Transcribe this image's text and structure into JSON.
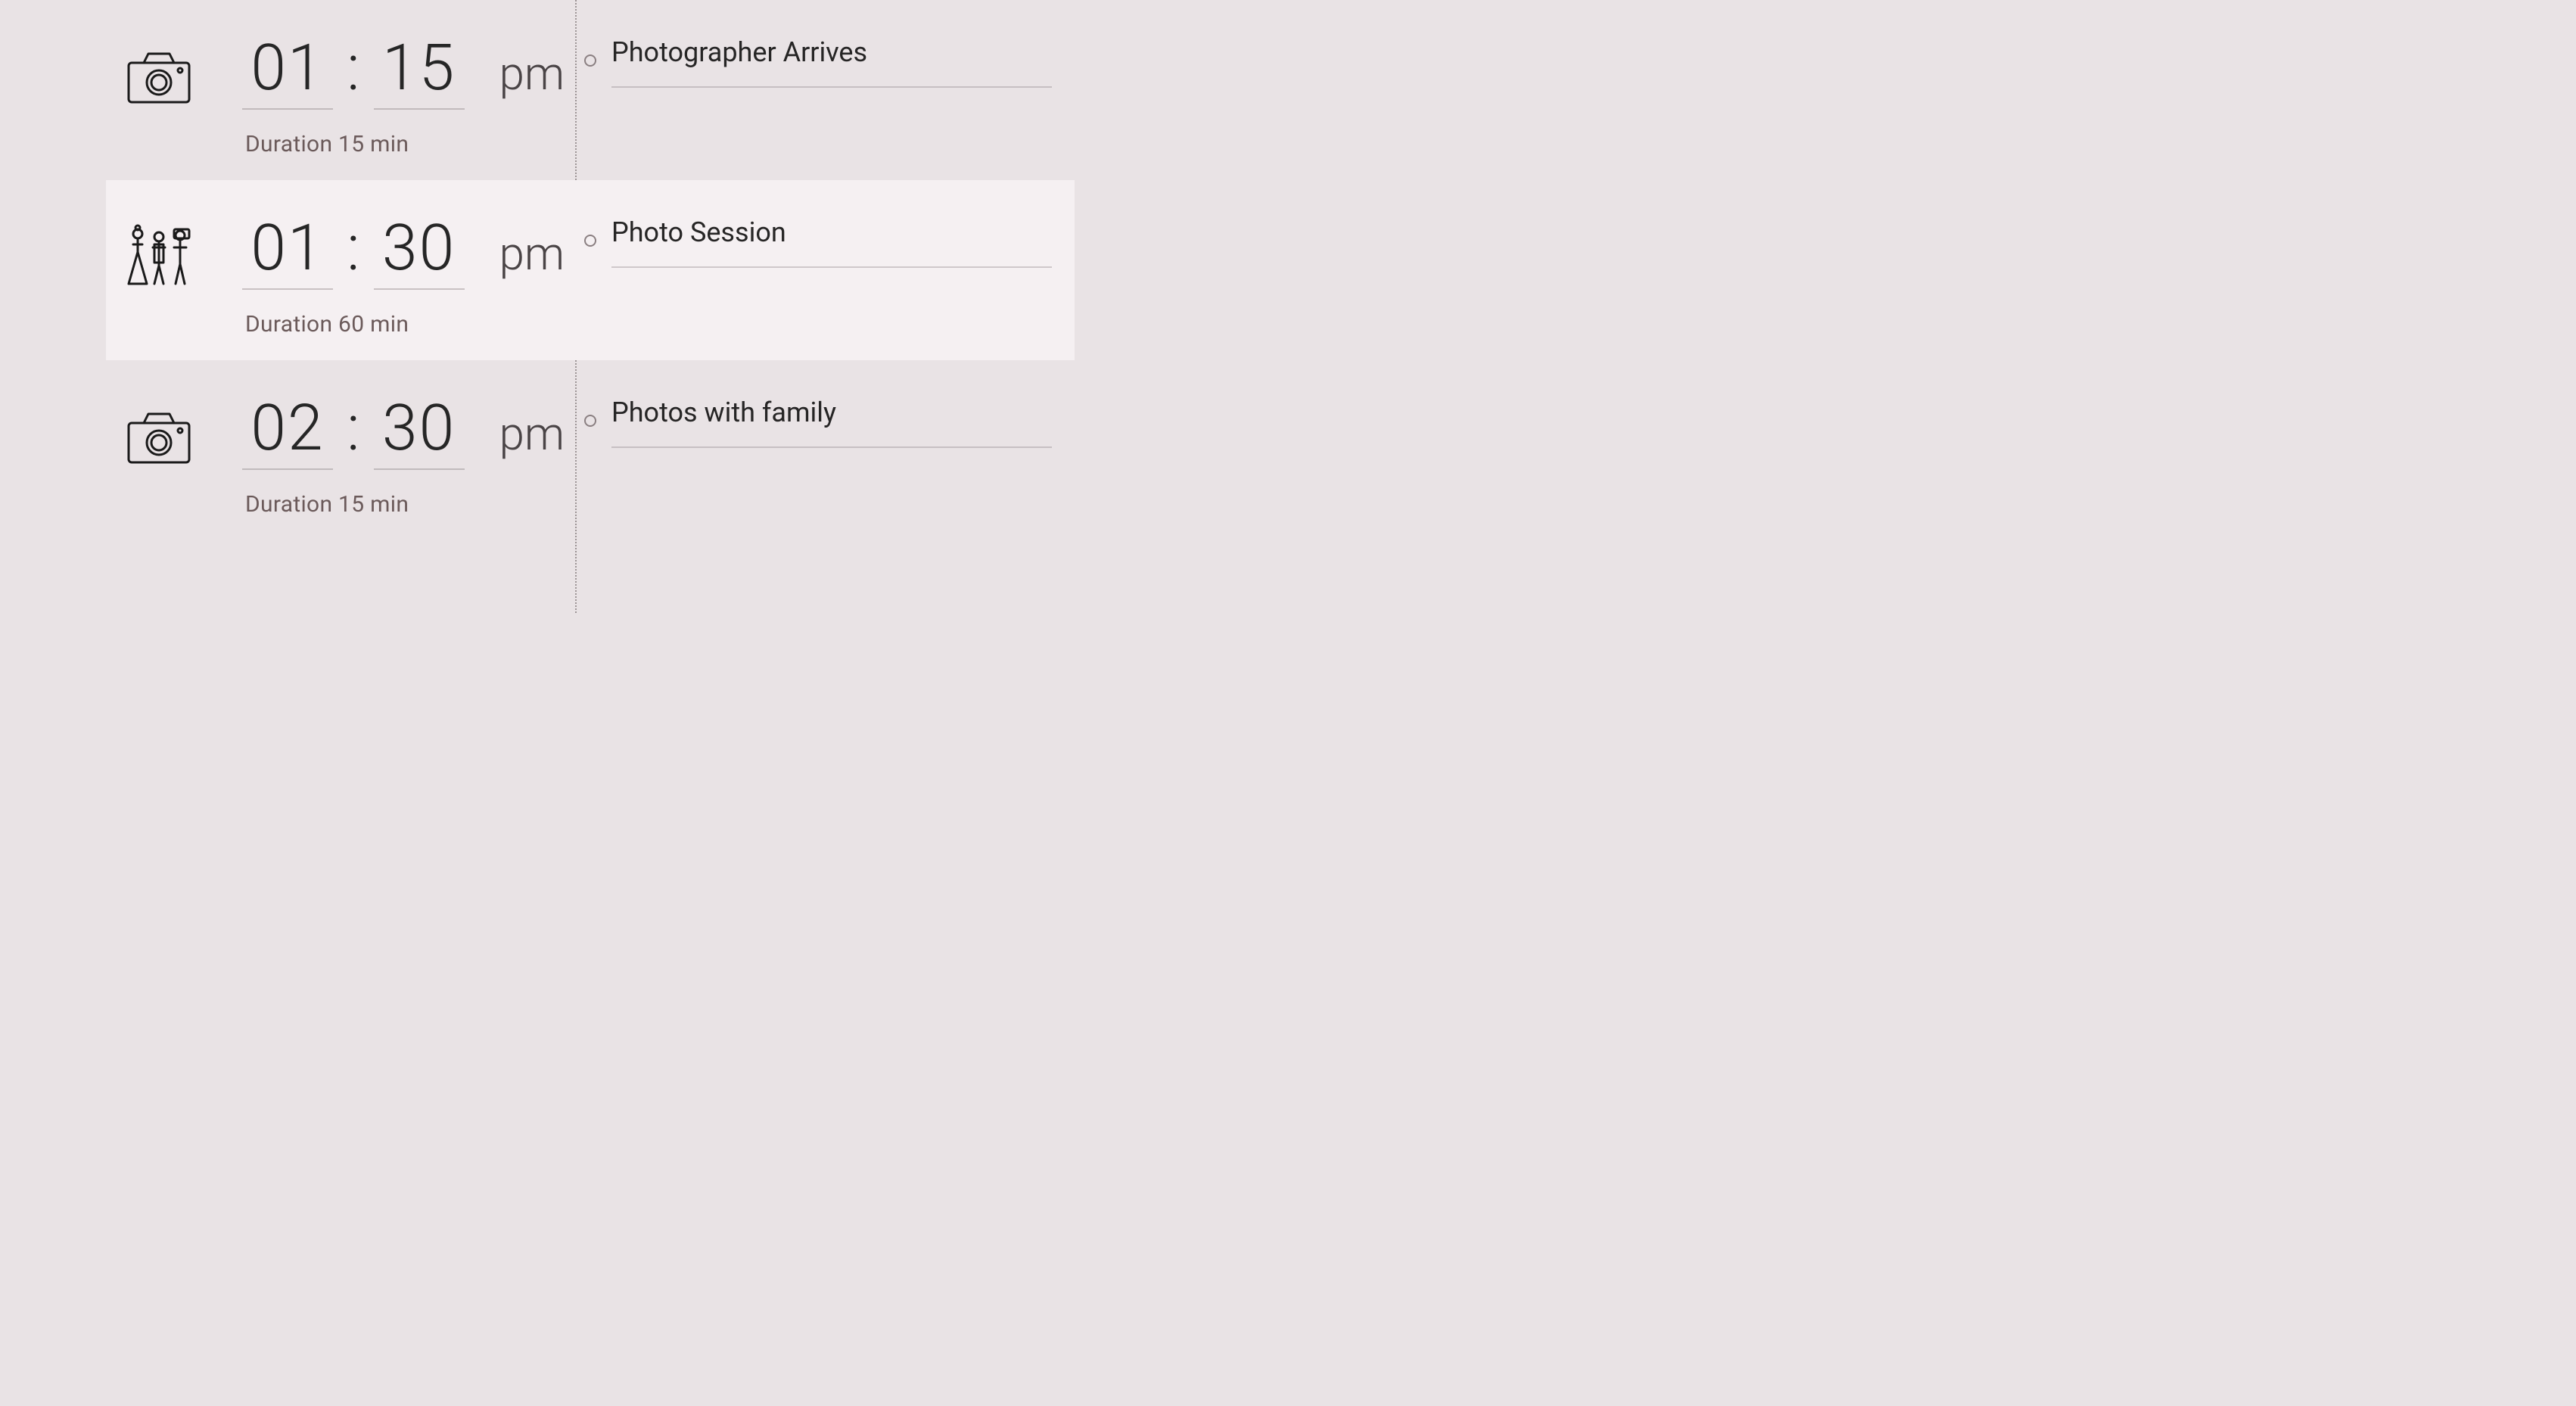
{
  "timeline": {
    "events": [
      {
        "icon": "camera",
        "hour": "01",
        "minute": "15",
        "ampm": "pm",
        "duration": "Duration 15 min",
        "title": "Photographer Arrives",
        "highlight": false
      },
      {
        "icon": "people",
        "hour": "01",
        "minute": "30",
        "ampm": "pm",
        "duration": "Duration 60 min",
        "title": "Photo Session",
        "highlight": true
      },
      {
        "icon": "camera",
        "hour": "02",
        "minute": "30",
        "ampm": "pm",
        "duration": "Duration 15 min",
        "title": "Photos with family",
        "highlight": false
      }
    ]
  }
}
